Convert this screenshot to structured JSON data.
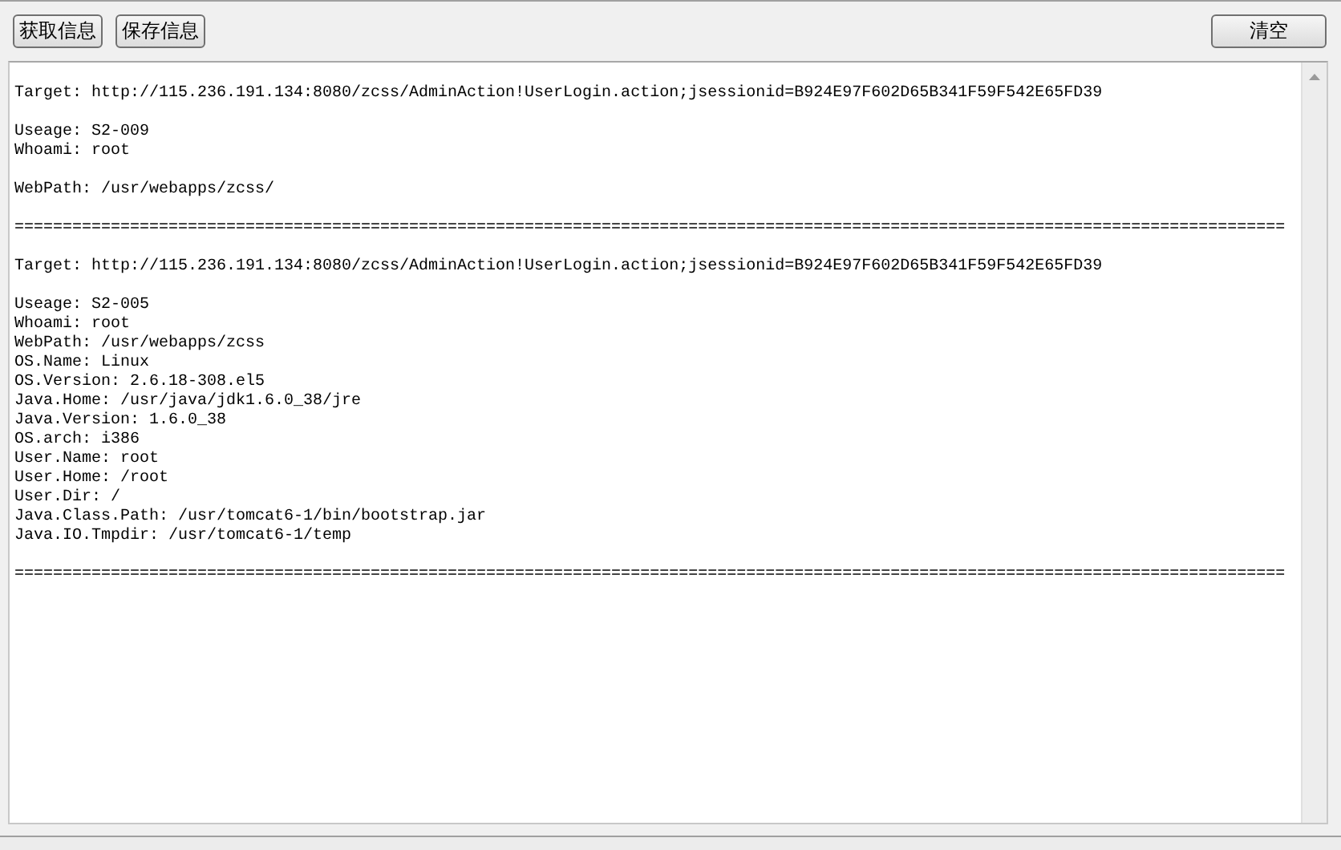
{
  "toolbar": {
    "buttons": [
      {
        "label": "获取信息"
      },
      {
        "label": "保存信息"
      }
    ],
    "clear_button": {
      "label": "清空"
    }
  },
  "output": {
    "text": "\nTarget: http://115.236.191.134:8080/zcss/AdminAction!UserLogin.action;jsessionid=B924E97F602D65B341F59F542E65FD39\n\nUseage: S2-009\nWhoami: root\n\nWebPath: /usr/webapps/zcss/\n\n====================================================================================================================================\n\nTarget: http://115.236.191.134:8080/zcss/AdminAction!UserLogin.action;jsessionid=B924E97F602D65B341F59F542E65FD39\n\nUseage: S2-005\nWhoami: root\nWebPath: /usr/webapps/zcss\nOS.Name: Linux\nOS.Version: 2.6.18-308.el5\nJava.Home: /usr/java/jdk1.6.0_38/jre\nJava.Version: 1.6.0_38\nOS.arch: i386\nUser.Name: root\nUser.Home: /root\nUser.Dir: /\nJava.Class.Path: /usr/tomcat6-1/bin/bootstrap.jar\nJava.IO.Tmpdir: /usr/tomcat6-1/temp\n\n===================================================================================================================================="
  }
}
